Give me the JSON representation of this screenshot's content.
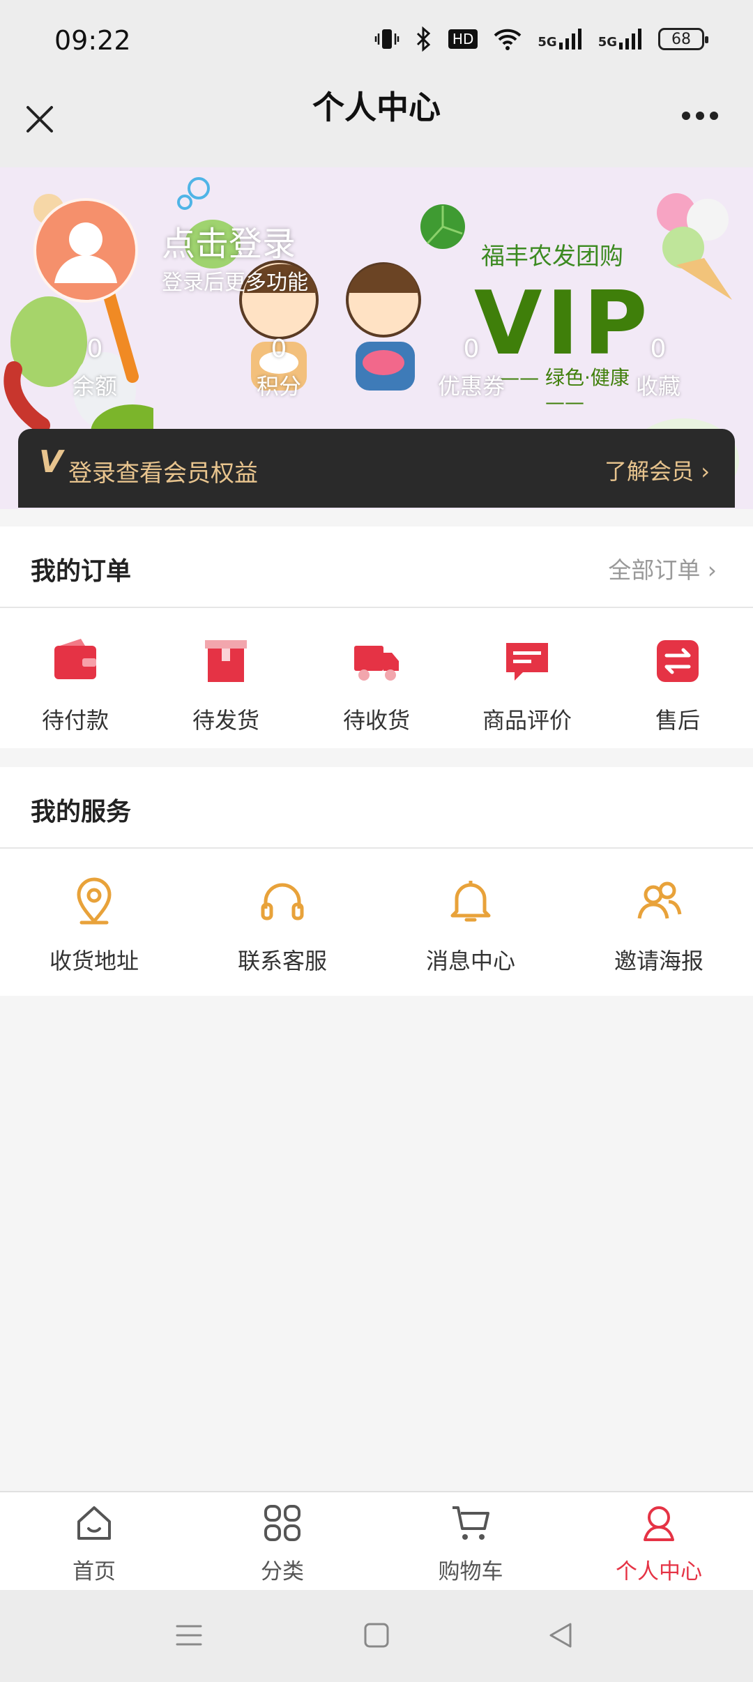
{
  "status_bar": {
    "time": "09:22",
    "network_a": "5G",
    "network_b": "5G",
    "hd_label": "HD",
    "battery": "68"
  },
  "navbar": {
    "title": "个人中心"
  },
  "banner": {
    "login_title": "点击登录",
    "login_subtitle": "登录后更多功能",
    "brand_name": "福丰农发团购",
    "vip": "VIP",
    "slogan": "—— 绿色·健康 ——",
    "stats": [
      {
        "value": "0",
        "label": "余额"
      },
      {
        "value": "0",
        "label": "积分"
      },
      {
        "value": "0",
        "label": "优惠券"
      },
      {
        "value": "0",
        "label": "收藏"
      }
    ],
    "member_bar": {
      "v": "V",
      "text": "登录查看会员权益",
      "link": "了解会员 ›"
    }
  },
  "orders": {
    "title": "我的订单",
    "all_label": "全部订单 ›",
    "items": [
      {
        "label": "待付款",
        "icon": "wallet-icon"
      },
      {
        "label": "待发货",
        "icon": "box-icon"
      },
      {
        "label": "待收货",
        "icon": "truck-icon"
      },
      {
        "label": "商品评价",
        "icon": "comment-icon"
      },
      {
        "label": "售后",
        "icon": "exchange-icon"
      }
    ]
  },
  "services": {
    "title": "我的服务",
    "items": [
      {
        "label": "收货地址",
        "icon": "location-icon"
      },
      {
        "label": "联系客服",
        "icon": "headset-icon"
      },
      {
        "label": "消息中心",
        "icon": "bell-icon"
      },
      {
        "label": "邀请海报",
        "icon": "users-icon"
      }
    ]
  },
  "tabbar": {
    "items": [
      {
        "label": "首页",
        "icon": "home-icon"
      },
      {
        "label": "分类",
        "icon": "category-icon"
      },
      {
        "label": "购物车",
        "icon": "cart-icon"
      },
      {
        "label": "个人中心",
        "icon": "profile-icon"
      }
    ],
    "active_color": "#e53345"
  },
  "colors": {
    "accent_red": "#e53345",
    "service_orange": "#e8a23a",
    "vip_green": "#3f7f0a",
    "gold": "#e8c48e"
  }
}
